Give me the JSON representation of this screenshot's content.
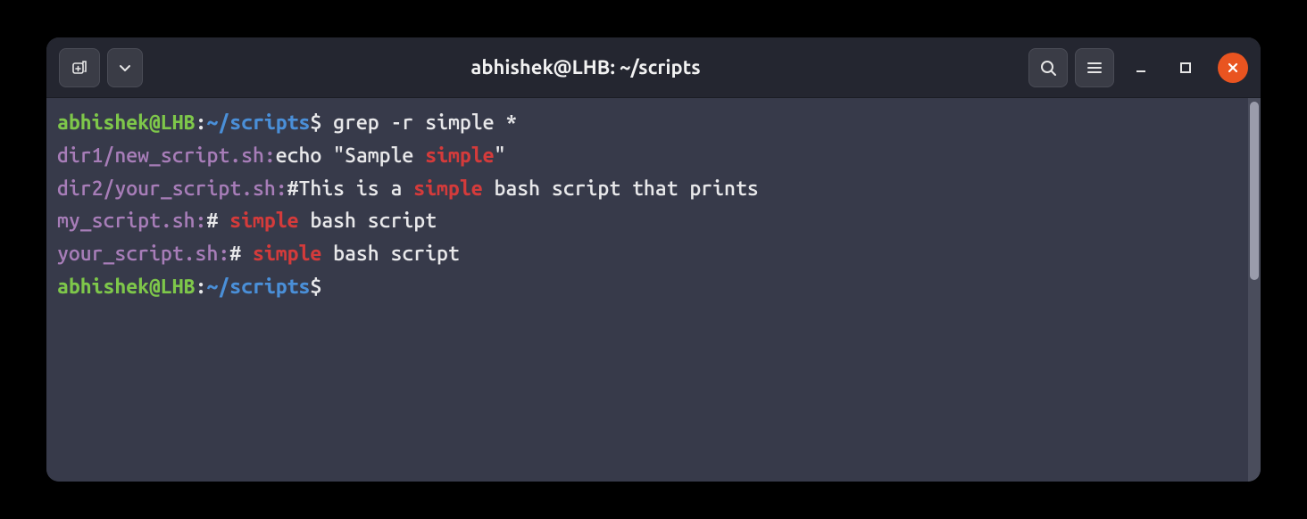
{
  "titlebar": {
    "title": "abhishek@LHB: ~/scripts"
  },
  "prompt": {
    "user": "abhishek@LHB",
    "sep": ":",
    "path": "~/scripts",
    "symbol": "$"
  },
  "command": "grep -r simple *",
  "results": [
    {
      "file": "dir1/new_script.sh:",
      "pre": "echo \"Sample ",
      "match": "simple",
      "post": "\""
    },
    {
      "file": "dir2/your_script.sh:",
      "pre": "#This is a ",
      "match": "simple",
      "post": " bash script that prints"
    },
    {
      "file": "my_script.sh:",
      "pre": "# ",
      "match": "simple",
      "post": " bash script"
    },
    {
      "file": "your_script.sh:",
      "pre": "# ",
      "match": "simple",
      "post": " bash script"
    }
  ],
  "colors": {
    "user": "#7ec74a",
    "path": "#4a8fd8",
    "file": "#a77db8",
    "match": "#d43b3b",
    "text": "#e8e8ea",
    "accent_close": "#e95420"
  }
}
